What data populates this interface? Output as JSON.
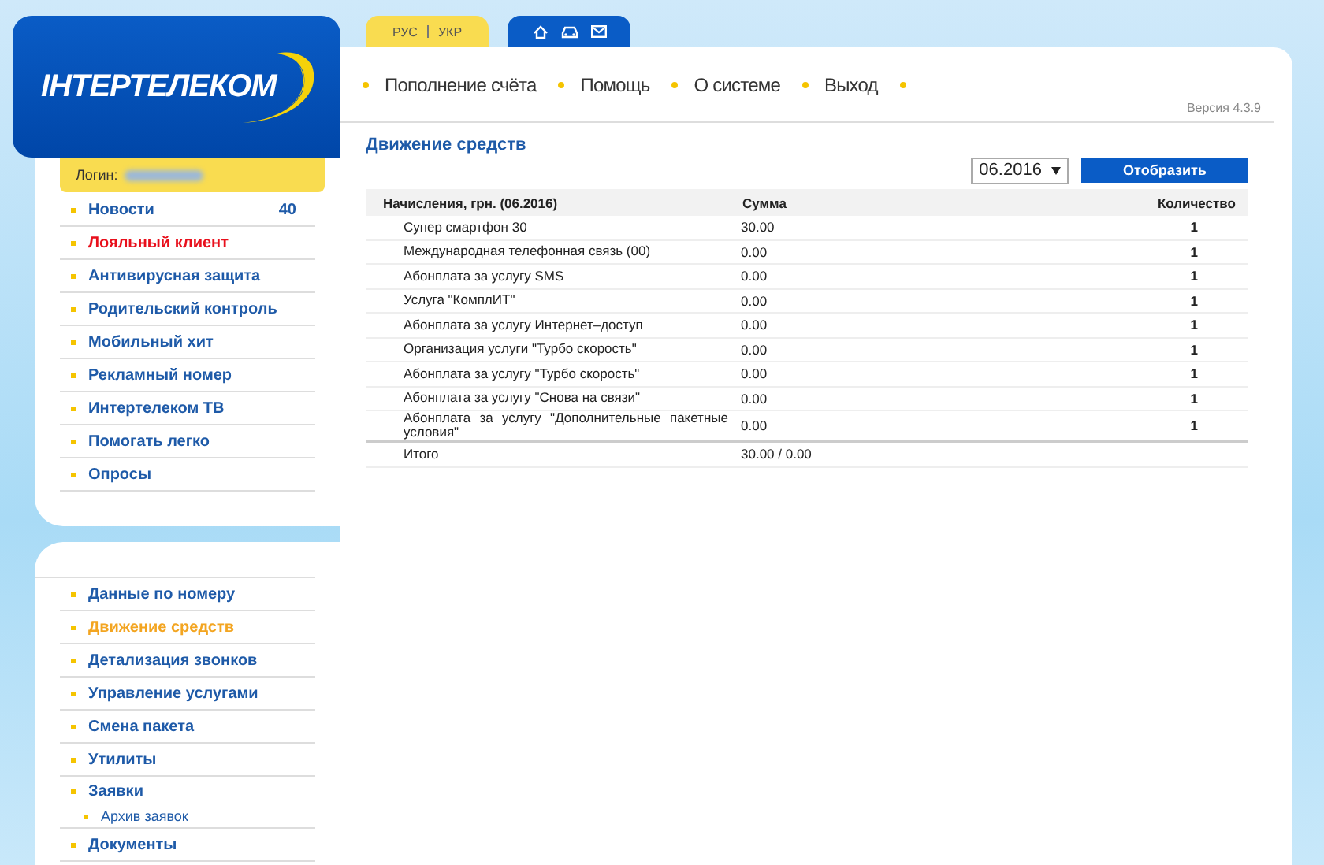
{
  "logo": {
    "text": "ІНТЕРТЕЛЕКОМ"
  },
  "language_tab": {
    "items": [
      {
        "label": "РУС",
        "selected": false
      },
      {
        "label": "УКР",
        "selected": false
      }
    ]
  },
  "top_nav": [
    "Пополнение счёта",
    "Помощь",
    "О системе",
    "Выход"
  ],
  "version": "Версия 4.3.9",
  "login": {
    "label": "Логин:"
  },
  "menu": [
    {
      "label": "Новости",
      "badge": "40",
      "highlighted": false
    },
    {
      "label": "Лояльный клиент",
      "highlighted": true
    },
    {
      "label": "Антивирусная защита",
      "highlighted": false
    },
    {
      "label": "Родительский контроль",
      "highlighted": false
    },
    {
      "label": "Мобильный хит",
      "highlighted": false
    },
    {
      "label": "Рекламный номер",
      "highlighted": false
    },
    {
      "label": "Интертелеком ТВ",
      "highlighted": false
    },
    {
      "label": "Помогать легко",
      "highlighted": false
    },
    {
      "label": "Опросы",
      "highlighted": false
    }
  ],
  "account_menu": [
    {
      "label": "Данные по номеру",
      "selected": false
    },
    {
      "label": "Движение средств",
      "selected": true
    },
    {
      "label": "Детализация звонков",
      "selected": false
    },
    {
      "label": "Управление услугами",
      "selected": false
    },
    {
      "label": "Смена пакета",
      "selected": false
    },
    {
      "label": "Утилиты",
      "selected": false
    },
    {
      "label": "Заявки",
      "selected": false,
      "children": [
        {
          "label": "Архив заявок",
          "selected": false
        }
      ]
    },
    {
      "label": "Документы",
      "selected": false
    }
  ],
  "page_title": "Движение средств",
  "period_select": {
    "value": "06.2016"
  },
  "show_button": "Отобразить",
  "table": {
    "columns": [
      "Начисления, грн. (06.2016)",
      "Сумма",
      "Количество"
    ],
    "rows": [
      {
        "name": "Супер смартфон 30",
        "sum": "30.00",
        "count": "1"
      },
      {
        "name": "Международная телефонная связь (00)",
        "sum": "0.00",
        "count": "1"
      },
      {
        "name": "Абонплата за услугу SMS",
        "sum": "0.00",
        "count": "1"
      },
      {
        "name": "Услуга \"КомплИТ\"",
        "sum": "0.00",
        "count": "1"
      },
      {
        "name": "Абонплата за услугу Интернет–доступ",
        "sum": "0.00",
        "count": "1"
      },
      {
        "name": "Организация услуги \"Турбо скорость\"",
        "sum": "0.00",
        "count": "1"
      },
      {
        "name": "Абонплата за услугу \"Турбо скорость\"",
        "sum": "0.00",
        "count": "1"
      },
      {
        "name": "Абонплата за услугу \"Снова на связи\"",
        "sum": "0.00",
        "count": "1"
      },
      {
        "name": "Абонплата за услугу \"Дополнительные пакетные условия\"",
        "sum": "0.00",
        "count": "1"
      }
    ],
    "total": {
      "name": "Итого",
      "sum": "30.00 / 0.00"
    }
  }
}
